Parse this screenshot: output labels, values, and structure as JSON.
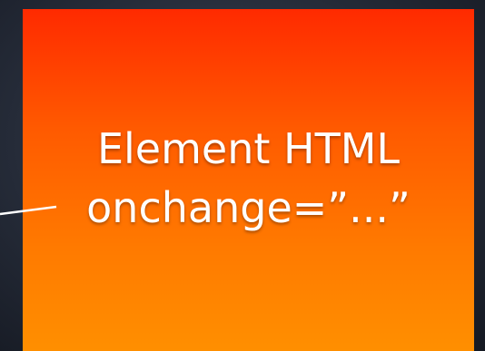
{
  "slide": {
    "line1": "Element HTML",
    "line2": "onchange=”...”"
  },
  "colors": {
    "background": "#252b38",
    "box_top": "#ff2a00",
    "box_bottom": "#ff8f00",
    "text": "#ffffff",
    "connector": "#ffffff"
  }
}
